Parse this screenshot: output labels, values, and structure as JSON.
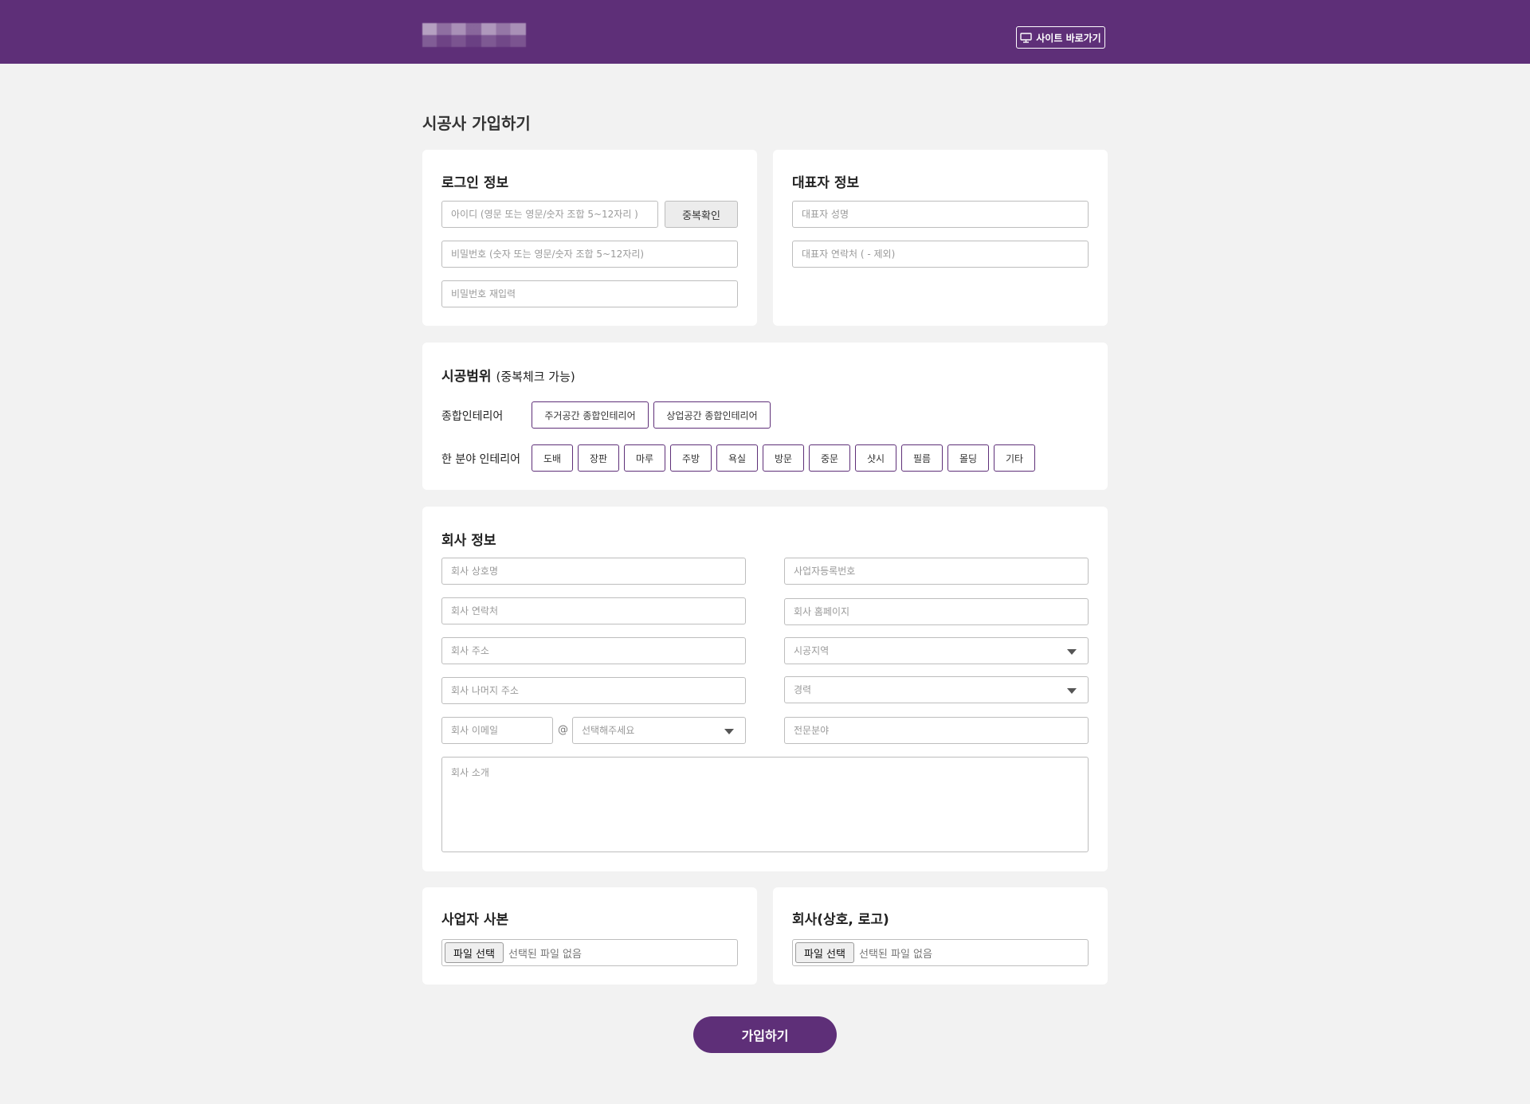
{
  "header": {
    "site_button_label": "사이트 바로가기"
  },
  "page_title": "시공사 가입하기",
  "login_info": {
    "title": "로그인 정보",
    "id_placeholder": "아이디 (영문 또는 영문/숫자 조합 5~12자리 )",
    "dup_check_label": "중복확인",
    "password_placeholder": "비밀번호 (숫자 또는 영문/숫자 조합 5~12자리)",
    "password_confirm_placeholder": "비밀번호 재입력"
  },
  "rep_info": {
    "title": "대표자 정보",
    "name_placeholder": "대표자 성명",
    "phone_placeholder": "대표자 연락처 ( - 제외)"
  },
  "scope": {
    "title": "시공범위",
    "subtitle": "(중복체크 가능)",
    "general_label": "종합인테리어",
    "general_options": [
      "주거공간 종합인테리어",
      "상업공간 종합인테리어"
    ],
    "partial_label": "한 분야 인테리어",
    "partial_options": [
      "도배",
      "장판",
      "마루",
      "주방",
      "욕실",
      "방문",
      "중문",
      "샷시",
      "필름",
      "몰딩",
      "기타"
    ]
  },
  "company": {
    "title": "회사 정보",
    "name_placeholder": "회사 상호명",
    "business_no_placeholder": "사업자등록번호",
    "phone_placeholder": "회사 연락처",
    "homepage_placeholder": "회사 홈페이지",
    "address_placeholder": "회사 주소",
    "region_select": "시공지역",
    "address_detail_placeholder": "회사 나머지 주소",
    "career_select": "경력",
    "email_placeholder": "회사 이메일",
    "email_at": "@",
    "email_domain_select": "선택해주세요",
    "specialty_placeholder": "전문분야",
    "intro_placeholder": "회사 소개"
  },
  "business_copy": {
    "title": "사업자 사본",
    "file_button": "파일 선택",
    "file_status": "선택된 파일 없음"
  },
  "company_logo": {
    "title": "회사(상호, 로고)",
    "file_button": "파일 선택",
    "file_status": "선택된 파일 없음"
  },
  "submit_label": "가입하기",
  "colors": {
    "brand": "#5e2f78",
    "background": "#f2f2f2"
  }
}
